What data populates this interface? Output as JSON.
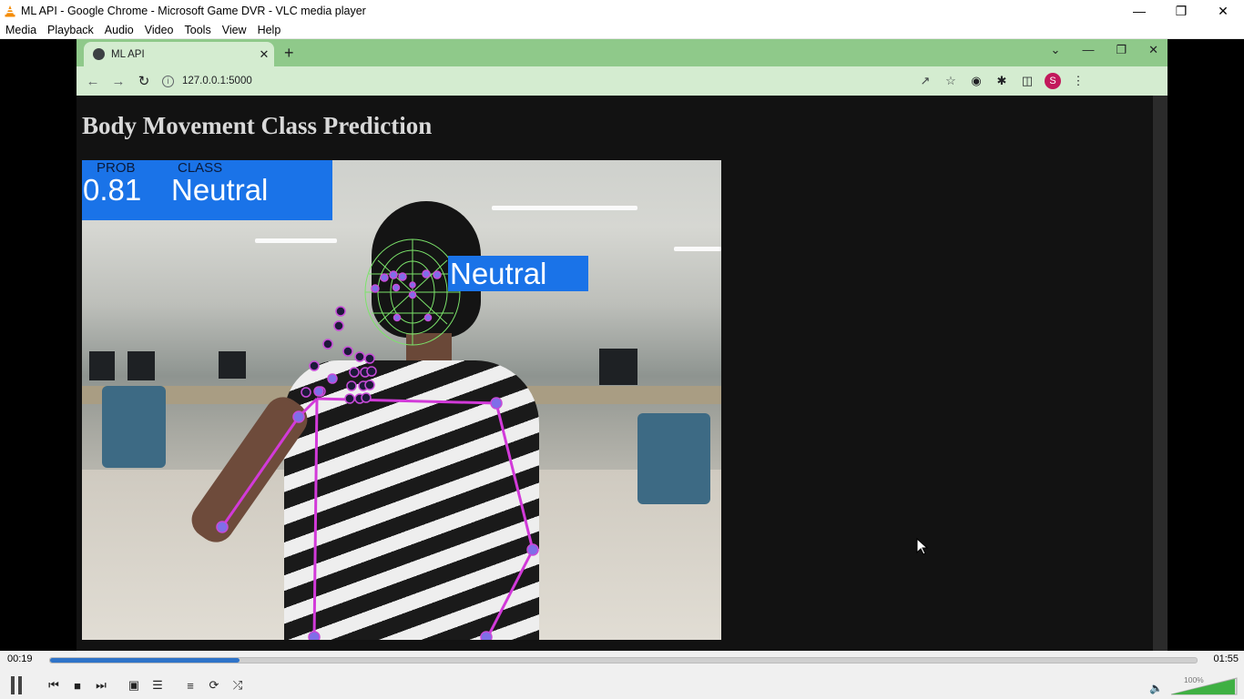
{
  "vlc": {
    "title": "ML API - Google Chrome - Microsoft Game DVR - VLC media player",
    "menu": [
      "Media",
      "Playback",
      "Audio",
      "Video",
      "Tools",
      "View",
      "Help"
    ],
    "time_elapsed": "00:19",
    "time_total": "01:55",
    "progress": 0.165,
    "volume": "100%"
  },
  "chrome": {
    "tab_title": "ML API",
    "url": "127.0.0.1:5000",
    "profile_initial": "S"
  },
  "page": {
    "title": "Body Movement Class Prediction",
    "prob_label": "PROB",
    "class_label": "CLASS",
    "prob_value": "0.81",
    "class_value": "Neutral",
    "face_label": "Neutral"
  },
  "colors": {
    "tab_bar": "#8fc98a",
    "toolbar": "#d4ecd0",
    "label_box": "#1a73e8",
    "pose_line": "#d23ad9",
    "face_mesh": "#7be36a",
    "seek_fill": "#2f74c9"
  },
  "icons": {
    "window_controls": [
      "minimize-icon",
      "maximize-icon",
      "close-icon"
    ],
    "playback": [
      "pause-icon",
      "previous-icon",
      "stop-icon",
      "next-icon",
      "fullscreen-icon",
      "extended-settings-icon",
      "playlist-icon",
      "loop-icon",
      "shuffle-icon"
    ]
  }
}
